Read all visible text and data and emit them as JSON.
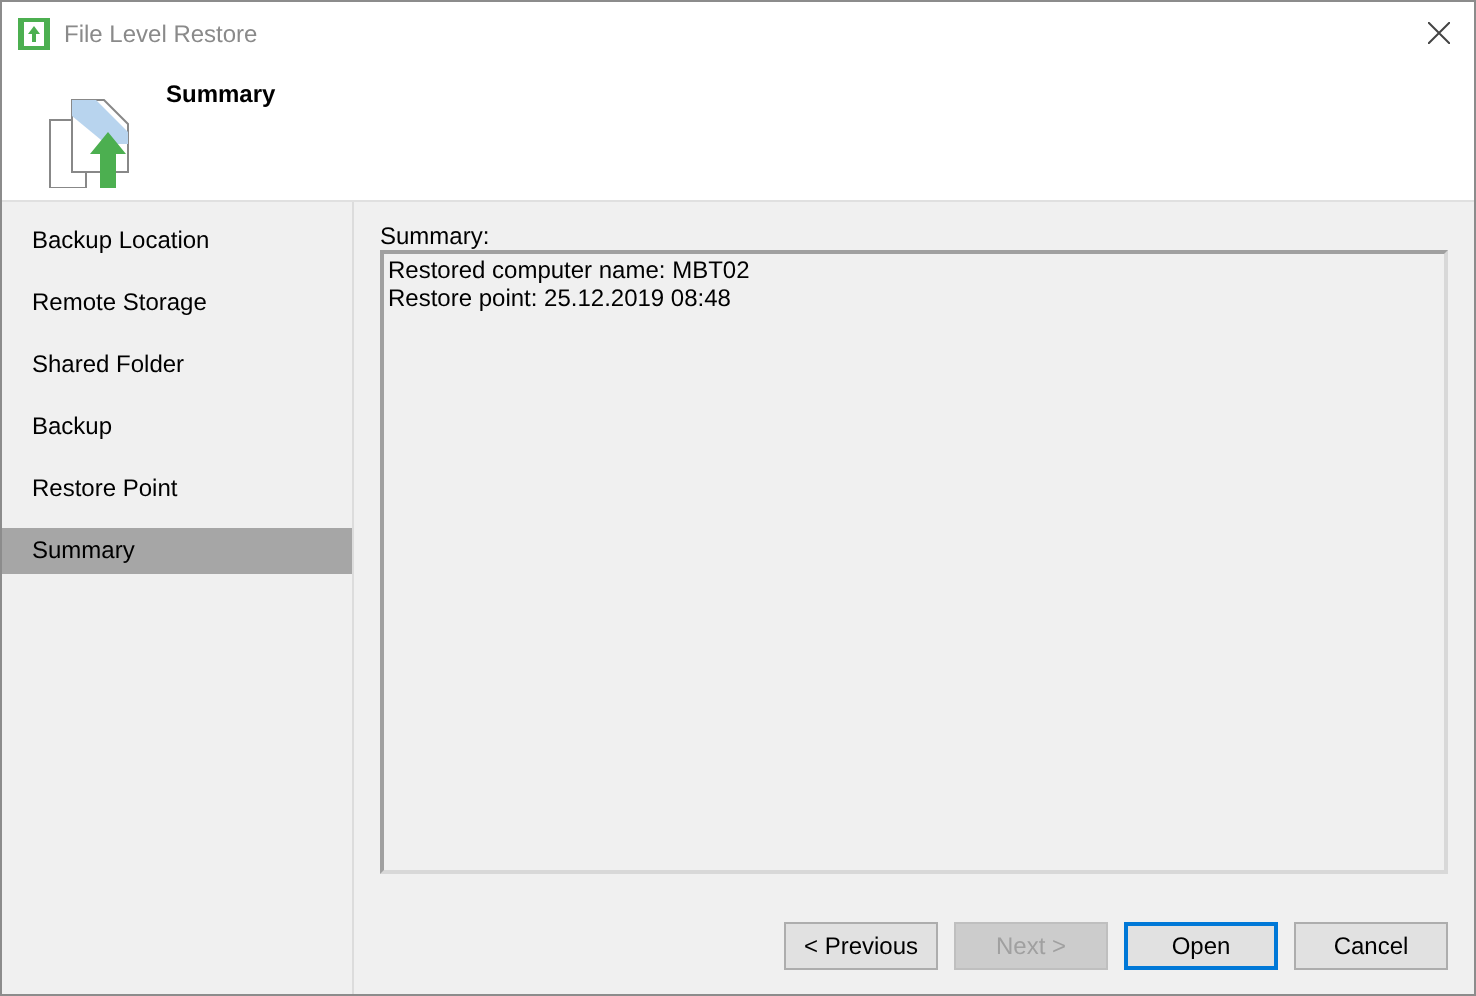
{
  "window": {
    "title": "File Level Restore"
  },
  "header": {
    "title": "Summary"
  },
  "steps": [
    {
      "label": "Backup Location",
      "selected": false
    },
    {
      "label": "Remote Storage",
      "selected": false
    },
    {
      "label": "Shared Folder",
      "selected": false
    },
    {
      "label": "Backup",
      "selected": false
    },
    {
      "label": "Restore Point",
      "selected": false
    },
    {
      "label": "Summary",
      "selected": true
    }
  ],
  "summary": {
    "label": "Summary:",
    "lines": [
      "Restored computer name: MBT02",
      "Restore point: 25.12.2019 08:48"
    ]
  },
  "buttons": [
    {
      "label": "< Previous",
      "disabled": false,
      "default": false
    },
    {
      "label": "Next >",
      "disabled": true,
      "default": false
    },
    {
      "label": "Open",
      "disabled": false,
      "default": true
    },
    {
      "label": "Cancel",
      "disabled": false,
      "default": false
    }
  ]
}
